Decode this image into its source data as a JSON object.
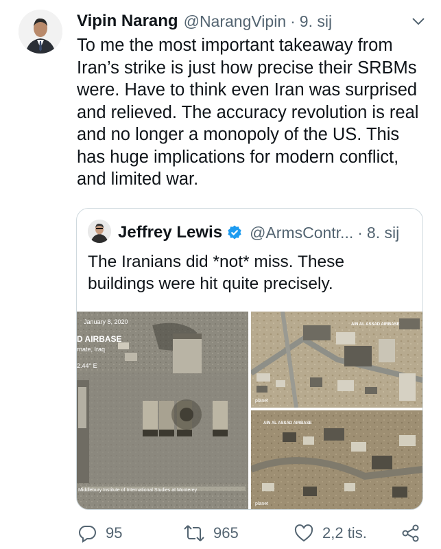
{
  "tweet": {
    "author_name": "Vipin Narang",
    "author_handle": "@NarangVipin",
    "separator": "·",
    "date": "9. sij",
    "text": "To me the most important takeaway from Iran’s strike is just how precise their SRBMs were. Have to think even Iran was surprised and relieved. The accuracy revolution is real and no longer a monopoly of the US. This has huge implications for modern conflict, and limited war."
  },
  "quoted": {
    "author_name": "Jeffrey Lewis",
    "author_handle": "@ArmsContr...",
    "separator": "·",
    "date": "8. sij",
    "text": "The Iranians did *not* miss. These buildings were hit quite precisely.",
    "image_left": {
      "date": "January 8, 2020",
      "title": "D AIRBASE",
      "location": "rnate, Iraq",
      "coords": "2.44° E",
      "credit": "Middlebury Institute of\nInternational Studies at Monterey"
    },
    "image_top_right": {
      "title": "AIN AL ASSAD AIRBASE",
      "credit": "planet"
    },
    "image_bottom_right": {
      "title": "AIN AL ASSAD AIRBASE",
      "credit": "planet"
    }
  },
  "actions": {
    "replies": "95",
    "retweets": "965",
    "likes": "2,2 tis."
  },
  "icons": [
    "chevron-down-icon",
    "verified-badge-icon",
    "reply-icon",
    "retweet-icon",
    "like-icon",
    "share-icon"
  ],
  "colors": {
    "text": "#0f1419",
    "secondary": "#536471",
    "verified": "#1d9bf0",
    "border": "#cfd9de"
  }
}
